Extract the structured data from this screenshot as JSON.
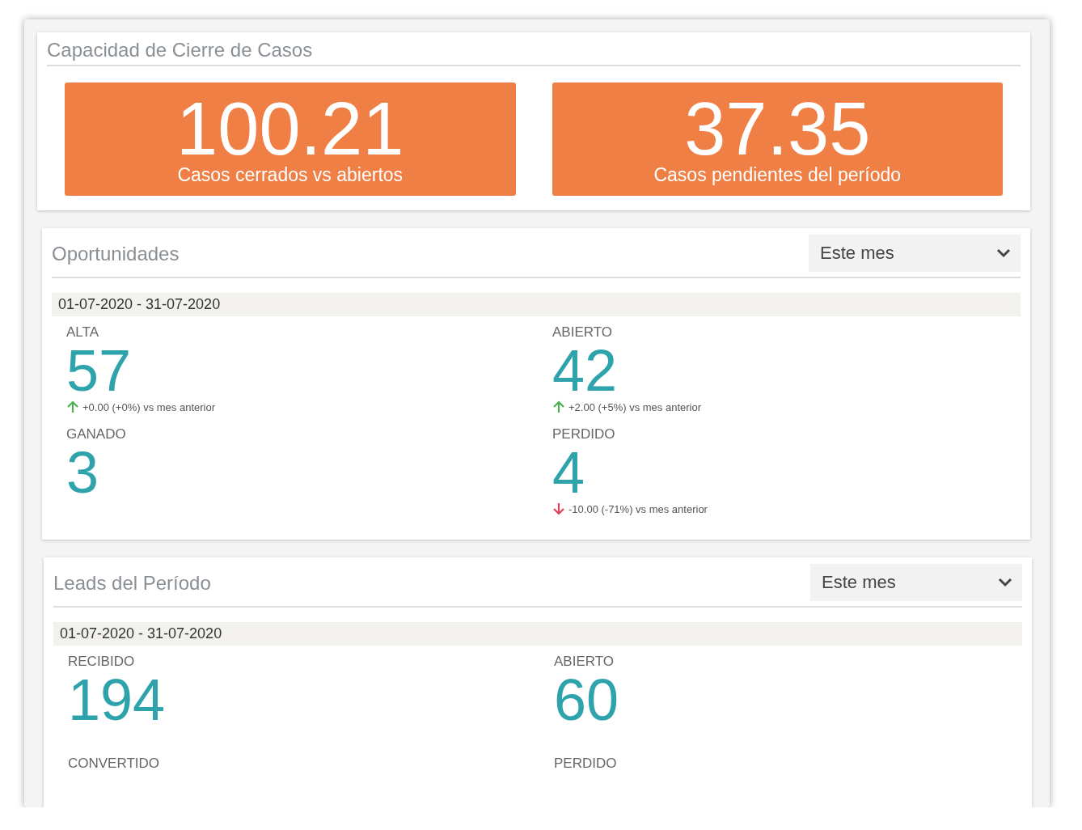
{
  "capacity": {
    "title": "Capacidad de Cierre de Casos",
    "tiles": [
      {
        "value": "100.21",
        "caption": "Casos cerrados vs abiertos"
      },
      {
        "value": "37.35",
        "caption": "Casos pendientes del período"
      }
    ]
  },
  "panels": [
    {
      "title": "Oportunidades",
      "period_select": "Este mes",
      "date_range": "01-07-2020 - 31-07-2020",
      "metrics": [
        {
          "label": "ALTA",
          "value": "57",
          "trend": {
            "kind": "up",
            "text": "+0.00 (+0%) vs mes anterior"
          }
        },
        {
          "label": "ABIERTO",
          "value": "42",
          "trend": {
            "kind": "up",
            "text": "+2.00 (+5%) vs mes anterior"
          }
        },
        {
          "label": "GANADO",
          "value": "3"
        },
        {
          "label": "PERDIDO",
          "value": "4",
          "trend": {
            "kind": "down",
            "text": "-10.00 (-71%) vs mes anterior"
          }
        }
      ]
    },
    {
      "title": "Leads del Período",
      "period_select": "Este mes",
      "date_range": "01-07-2020 - 31-07-2020",
      "metrics": [
        {
          "label": "RECIBIDO",
          "value": "194"
        },
        {
          "label": "ABIERTO",
          "value": "60"
        },
        {
          "label": "CONVERTIDO"
        },
        {
          "label": "PERDIDO"
        }
      ]
    }
  ]
}
